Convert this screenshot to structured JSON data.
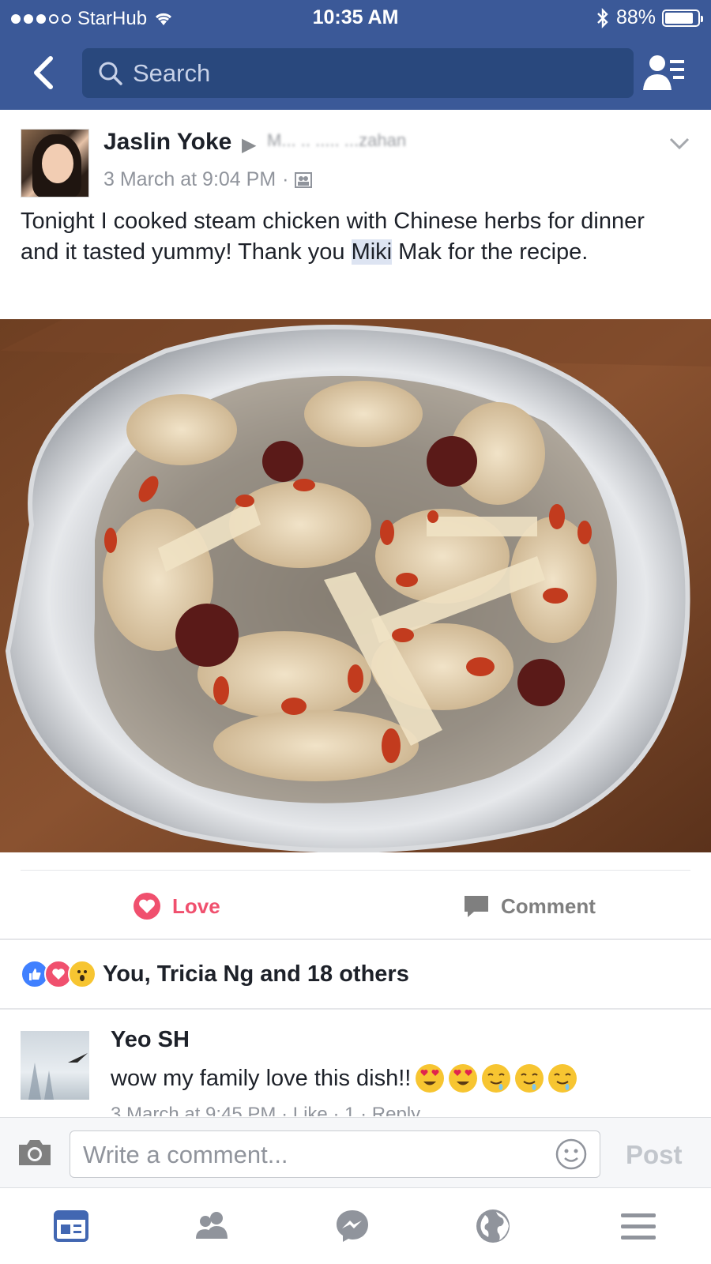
{
  "status_bar": {
    "carrier": "StarHub",
    "time": "10:35 AM",
    "battery": "88%",
    "battery_level": 0.88
  },
  "search": {
    "placeholder": "Search"
  },
  "post": {
    "author": "Jaslin Yoke",
    "target_blurred": "M... .. ..... ...zahan",
    "timestamp": "3 March at 9:04 PM",
    "text_before": "Tonight I cooked steam chicken with Chinese herbs for dinner and it tasted yummy! Thank you ",
    "text_highlight": "Miki",
    "text_after": " Mak for the recipe."
  },
  "actions": {
    "love_label": "Love",
    "comment_label": "Comment"
  },
  "reactions": {
    "summary": "You, Tricia Ng and 18 others"
  },
  "comment": {
    "name": "Yeo SH",
    "text": "wow my family love this dish!!",
    "meta": "3 March at 9:45 PM · Like · 1 · Reply"
  },
  "composer": {
    "placeholder": "Write a comment...",
    "post_label": "Post"
  },
  "colors": {
    "brand": "#3b5998",
    "love": "#f0506e",
    "search_bg": "#29487d"
  },
  "tabs": [
    "news-feed-icon",
    "friends-icon",
    "messenger-icon",
    "notifications-globe-icon",
    "menu-icon"
  ]
}
